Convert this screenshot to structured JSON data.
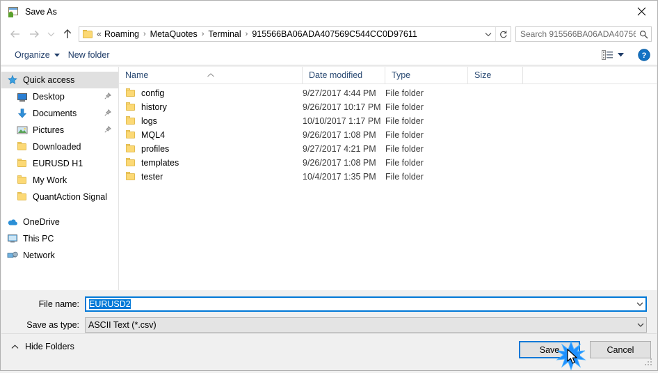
{
  "window": {
    "title": "Save As",
    "app_icon": "save-as-app-icon",
    "close_label": "✕"
  },
  "nav": {
    "back_icon": "back-arrow-icon",
    "forward_icon": "forward-arrow-icon",
    "recent_icon": "recent-locations-chevron-icon",
    "up_icon": "up-arrow-icon",
    "address": {
      "folder_icon": "folder-icon",
      "overflow": "«",
      "crumbs": [
        "Roaming",
        "MetaQuotes",
        "Terminal",
        "915566BA06ADA407569C544CC0D97611"
      ],
      "separator": "›",
      "dropdown_icon": "chevron-down-icon",
      "refresh_icon": "refresh-icon"
    },
    "search": {
      "placeholder": "Search 915566BA06ADA40756...",
      "icon": "search-icon"
    }
  },
  "toolbar": {
    "organize_label": "Organize",
    "organize_caret": "▼",
    "new_folder_label": "New folder",
    "view_icon": "view-layout-icon",
    "view_caret": "▼",
    "help_icon": "help-icon",
    "help_glyph": "?"
  },
  "sidebar": {
    "items": [
      {
        "label": "Quick access",
        "icon": "star-pin-icon",
        "selected": true,
        "pinned": false,
        "indent": "root"
      },
      {
        "label": "Desktop",
        "icon": "desktop-icon",
        "selected": false,
        "pinned": true,
        "indent": "child"
      },
      {
        "label": "Documents",
        "icon": "documents-icon",
        "selected": false,
        "pinned": true,
        "indent": "child"
      },
      {
        "label": "Pictures",
        "icon": "pictures-icon",
        "selected": false,
        "pinned": true,
        "indent": "child"
      },
      {
        "label": "Downloaded",
        "icon": "folder-icon",
        "selected": false,
        "pinned": false,
        "indent": "child"
      },
      {
        "label": "EURUSD H1",
        "icon": "folder-icon",
        "selected": false,
        "pinned": false,
        "indent": "child"
      },
      {
        "label": "My Work",
        "icon": "folder-icon",
        "selected": false,
        "pinned": false,
        "indent": "child"
      },
      {
        "label": "QuantAction Signal",
        "icon": "folder-icon",
        "selected": false,
        "pinned": false,
        "indent": "child"
      }
    ],
    "groups": [
      {
        "label": "OneDrive",
        "icon": "onedrive-icon"
      },
      {
        "label": "This PC",
        "icon": "this-pc-icon"
      },
      {
        "label": "Network",
        "icon": "network-icon"
      }
    ]
  },
  "filelist": {
    "columns": [
      "Name",
      "Date modified",
      "Type",
      "Size"
    ],
    "sort_column": "Name",
    "sort_direction": "ascending",
    "sort_glyph": "˄",
    "rows": [
      {
        "name": "config",
        "date": "9/27/2017 4:44 PM",
        "type": "File folder",
        "size": "",
        "icon": "folder-icon"
      },
      {
        "name": "history",
        "date": "9/26/2017 10:17 PM",
        "type": "File folder",
        "size": "",
        "icon": "folder-icon"
      },
      {
        "name": "logs",
        "date": "10/10/2017 1:17 PM",
        "type": "File folder",
        "size": "",
        "icon": "folder-icon"
      },
      {
        "name": "MQL4",
        "date": "9/26/2017 1:08 PM",
        "type": "File folder",
        "size": "",
        "icon": "folder-icon"
      },
      {
        "name": "profiles",
        "date": "9/27/2017 4:21 PM",
        "type": "File folder",
        "size": "",
        "icon": "folder-icon"
      },
      {
        "name": "templates",
        "date": "9/26/2017 1:08 PM",
        "type": "File folder",
        "size": "",
        "icon": "folder-icon"
      },
      {
        "name": "tester",
        "date": "10/4/2017 1:35 PM",
        "type": "File folder",
        "size": "",
        "icon": "folder-icon"
      }
    ]
  },
  "form": {
    "filename_label": "File name:",
    "filename_value": "EURUSD2",
    "filename_selected": true,
    "filetype_label": "Save as type:",
    "filetype_value": "ASCII Text (*.csv)",
    "dropdown_icon": "chevron-down-icon"
  },
  "footer": {
    "hide_folders_label": "Hide Folders",
    "hide_folders_icon": "chevron-up-icon",
    "save_label": "Save",
    "cancel_label": "Cancel",
    "resize_grip_icon": "resize-grip-icon"
  },
  "pointer": {
    "click_effect_icon": "click-burst-icon",
    "cursor_icon": "mouse-cursor-icon",
    "accent_color": "#0078d7"
  }
}
